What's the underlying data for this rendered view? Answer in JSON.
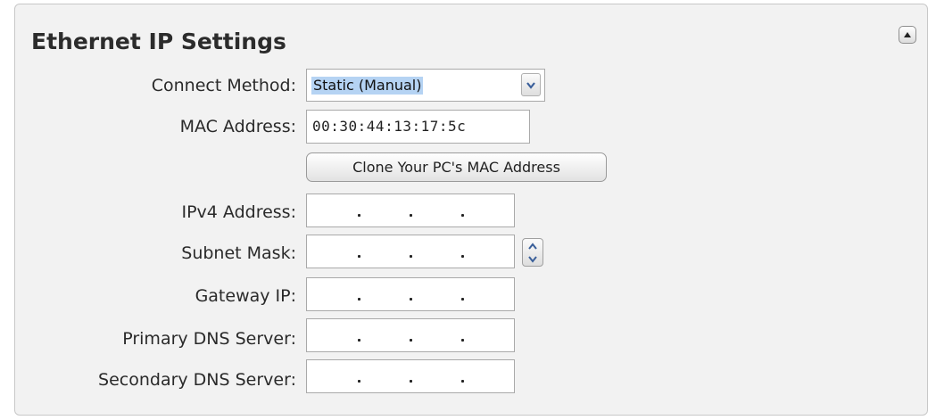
{
  "panel": {
    "title": "Ethernet IP Settings",
    "collapse_icon": "collapse-up-icon"
  },
  "connect_method": {
    "label": "Connect Method:",
    "selected": "Static (Manual)",
    "arrow_icon": "chevron-down-icon"
  },
  "mac_address": {
    "label": "MAC Address:",
    "value": "00:30:44:13:17:5c"
  },
  "clone_button": {
    "label": "Clone Your PC's MAC Address"
  },
  "fields": [
    {
      "label": "IPv4 Address:",
      "value": ". . ."
    },
    {
      "label": "Subnet Mask:",
      "value": ". . ."
    },
    {
      "label": "Gateway IP:",
      "value": ". . ."
    },
    {
      "label": "Primary DNS Server:",
      "value": ". . ."
    },
    {
      "label": "Secondary DNS Server:",
      "value": ". . ."
    }
  ],
  "subnet_stepper_icon": "up-down-stepper-icon",
  "colors": {
    "panel_bg": "#f2f2f2",
    "selection_highlight": "#b5d3f3",
    "arrow_blue": "#3a5f9a"
  }
}
